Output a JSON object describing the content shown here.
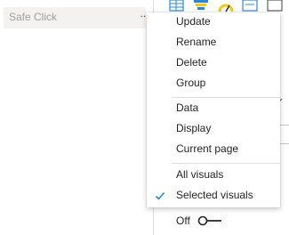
{
  "bookmark": {
    "name": "Safe Click",
    "more_icon": "more-options-icon"
  },
  "context_menu": {
    "groups": [
      [
        {
          "label": "Update"
        },
        {
          "label": "Rename"
        },
        {
          "label": "Delete"
        },
        {
          "label": "Group"
        }
      ],
      [
        {
          "label": "Data"
        },
        {
          "label": "Display"
        },
        {
          "label": "Current page"
        }
      ],
      [
        {
          "label": "All visuals",
          "checked": false
        },
        {
          "label": "Selected visuals",
          "checked": true
        }
      ]
    ],
    "check_icon": "checkmark-icon",
    "check_color": "#2b88d8"
  },
  "background_panel": {
    "toggle": {
      "label": "Off",
      "state": "off"
    },
    "icons": [
      "table-viz-icon",
      "funnel-viz-icon",
      "gauge-viz-icon",
      "card-viz-icon",
      "filter-viz-icon"
    ]
  },
  "colors": {
    "selection_bg": "#f3f2f1",
    "menu_separator": "#e1dfdd",
    "text": "#252423",
    "muted_text": "#a19f9d"
  }
}
